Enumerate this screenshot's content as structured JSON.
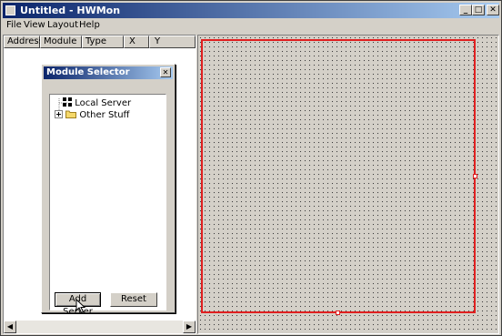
{
  "window": {
    "title": "Untitled - HWMon"
  },
  "caption_buttons": {
    "minimize": "_",
    "maximize": "□",
    "close": "✕"
  },
  "menu": {
    "items": [
      "File",
      "View",
      "Layout",
      "Help"
    ]
  },
  "list": {
    "columns": [
      "Address",
      "Module",
      "Type",
      "X",
      "Y"
    ]
  },
  "dialog": {
    "title": "Module Selector",
    "close_glyph": "✕",
    "tree": [
      {
        "label": "Local Server",
        "icon": "server-icon"
      },
      {
        "label": "Other Stuff",
        "icon": "folder-icon",
        "expandable": true
      }
    ],
    "buttons": {
      "add": "Add Server",
      "reset": "Reset"
    }
  },
  "scrollbar": {
    "left": "◀",
    "right": "▶"
  },
  "colors": {
    "title_gradient_start": "#0a246a",
    "title_gradient_end": "#a6caf0",
    "selection_outline": "#e02020"
  }
}
